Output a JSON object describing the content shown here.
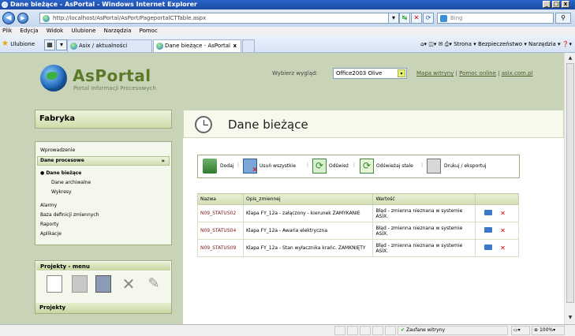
{
  "window": {
    "title": "Dane bieżące - AsPortal - Windows Internet Explorer",
    "minimize": "_",
    "maximize": "□",
    "close": "x"
  },
  "browser": {
    "url": "http://localhost/AsPortal/AsPort/PageportalCTTable.aspx",
    "search_placeholder": "Bing",
    "menu": [
      "Plik",
      "Edycja",
      "Widok",
      "Ulubione",
      "Narzędzia",
      "Pomoc"
    ],
    "favorites_label": "Ulubione",
    "tabs": [
      {
        "label": "Asix / aktualności"
      },
      {
        "label": "Dane bieżące - AsPortal"
      }
    ],
    "tab_close": "x",
    "commands": "Strona ▾  Bezpieczeństwo ▾  Narzędzia ▾"
  },
  "header": {
    "logo": "AsPortal",
    "logo_sub": "Portal Informacji Procesowych",
    "theme_label": "Wybierz wygląd:",
    "theme_value": "Office2003 Olive",
    "links": [
      "Mapa witryny",
      "Pomoc online",
      "asix.com.pl"
    ]
  },
  "sidebar": {
    "title": "Fabryka",
    "items": [
      {
        "label": "Wprowadzenie"
      },
      {
        "label": "Dane procesowe"
      },
      {
        "label": "Dane bieżące"
      },
      {
        "label": "Dane archiwalne"
      },
      {
        "label": "Wykresy"
      },
      {
        "label": "Alarmy"
      },
      {
        "label": "Baza definicji zmiennych"
      },
      {
        "label": "Raporty"
      },
      {
        "label": "Aplikacje"
      }
    ],
    "projects_menu": "Projekty - menu",
    "projects": "Projekty"
  },
  "main": {
    "title": "Dane bieżące",
    "toolbar": {
      "add": "Dodaj",
      "delete_all": "Usuń wszystkie",
      "refresh": "Odśwież",
      "refresh_const": "Odświeżaj stale",
      "print": "Drukuj / eksportuj"
    },
    "columns": [
      "Nazwa",
      "Opis_zmiennej",
      "Wartość"
    ],
    "rows": [
      {
        "name": "N09_STATUS02",
        "desc": "Klapa FY_12a - załączony - kierunek ZAMYKANIE",
        "value": "Błąd - zmienna nieznana w systemie ASIX."
      },
      {
        "name": "N09_STATUS04",
        "desc": "Klapa FY_12a - Awaria elektryczna",
        "value": "Błąd - zmienna nieznana w systemie ASIX."
      },
      {
        "name": "N09_STATUS09",
        "desc": "Klapa FY_12a - Stan wyłacznika krańc. ZAMKNIĘTY",
        "value": "Błąd - zmienna nieznana w systemie ASIX."
      }
    ]
  },
  "statusbar": {
    "zone": "Zaufane witryny",
    "zoom": "100%"
  },
  "colors": {
    "page_bg": "#c9d3b7",
    "accent": "#9fae80",
    "title_bar": "#2a63c9"
  }
}
